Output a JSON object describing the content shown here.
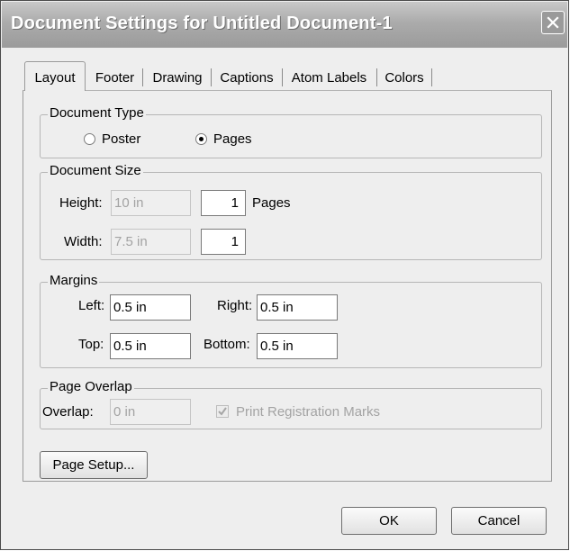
{
  "window": {
    "title": "Document Settings for Untitled Document-1"
  },
  "tabs": [
    {
      "label": "Layout",
      "active": true
    },
    {
      "label": "Footer"
    },
    {
      "label": "Drawing"
    },
    {
      "label": "Captions"
    },
    {
      "label": "Atom Labels"
    },
    {
      "label": "Colors"
    }
  ],
  "document_type": {
    "legend": "Document Type",
    "options": [
      {
        "label": "Poster",
        "selected": false
      },
      {
        "label": "Pages",
        "selected": true
      }
    ]
  },
  "document_size": {
    "legend": "Document Size",
    "height_label": "Height:",
    "height_value": "10 in",
    "height_pages": "1",
    "pages_label": "Pages",
    "width_label": "Width:",
    "width_value": "7.5 in",
    "width_pages": "1"
  },
  "margins": {
    "legend": "Margins",
    "left_label": "Left:",
    "left_value": "0.5 in",
    "right_label": "Right:",
    "right_value": "0.5 in",
    "top_label": "Top:",
    "top_value": "0.5 in",
    "bottom_label": "Bottom:",
    "bottom_value": "0.5 in"
  },
  "page_overlap": {
    "legend": "Page Overlap",
    "overlap_label": "Overlap:",
    "overlap_value": "0 in",
    "registration_label": "Print Registration Marks",
    "registration_checked": true
  },
  "buttons": {
    "page_setup": "Page Setup...",
    "ok": "OK",
    "cancel": "Cancel"
  }
}
